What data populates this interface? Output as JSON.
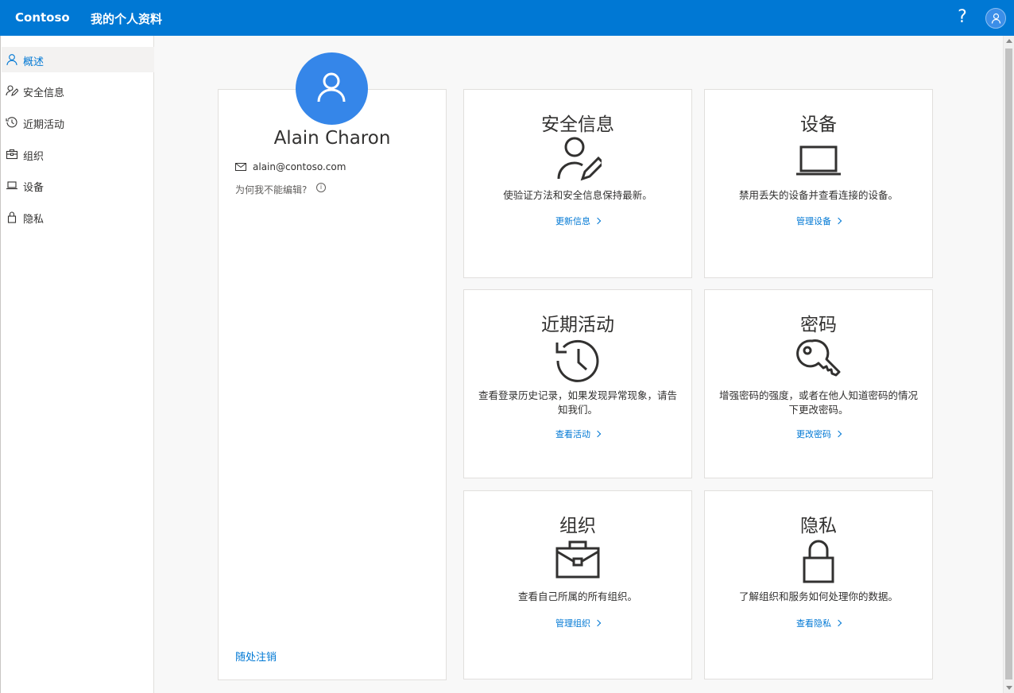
{
  "header": {
    "brand": "Contoso",
    "page_title": "我的个人资料",
    "help_label": "?",
    "colors": {
      "bar": "#0078d4",
      "avatar": "#3b8ee8"
    }
  },
  "sidebar": {
    "items": [
      {
        "label": "概述",
        "icon": "person-icon",
        "active": true
      },
      {
        "label": "安全信息",
        "icon": "person-edit-icon",
        "active": false
      },
      {
        "label": "近期活动",
        "icon": "history-icon",
        "active": false
      },
      {
        "label": "组织",
        "icon": "briefcase-icon",
        "active": false
      },
      {
        "label": "设备",
        "icon": "laptop-icon",
        "active": false
      },
      {
        "label": "隐私",
        "icon": "lock-icon",
        "active": false
      }
    ]
  },
  "profile": {
    "name": "Alain Charon",
    "email": "alain@contoso.com",
    "why_cannot_edit": "为何我不能编辑?",
    "info_icon": "info-icon",
    "signout_link": "随处注销",
    "avatar_color": "#3586e9"
  },
  "tiles": [
    {
      "title": "安全信息",
      "icon": "person-edit-icon",
      "description": "使验证方法和安全信息保持最新。",
      "link": "更新信息"
    },
    {
      "title": "设备",
      "icon": "laptop-icon",
      "description": "禁用丢失的设备并查看连接的设备。",
      "link": "管理设备"
    },
    {
      "title": "近期活动",
      "icon": "history-icon",
      "description": "查看登录历史记录，如果发现异常现象，请告知我们。",
      "link": "查看活动"
    },
    {
      "title": "密码",
      "icon": "key-icon",
      "description": "增强密码的强度，或者在他人知道密码的情况下更改密码。",
      "link": "更改密码"
    },
    {
      "title": "组织",
      "icon": "briefcase-icon",
      "description": "查看自己所属的所有组织。",
      "link": "管理组织"
    },
    {
      "title": "隐私",
      "icon": "lock-icon",
      "description": "了解组织和服务如何处理你的数据。",
      "link": "查看隐私"
    }
  ],
  "link_color": "#0078d4"
}
